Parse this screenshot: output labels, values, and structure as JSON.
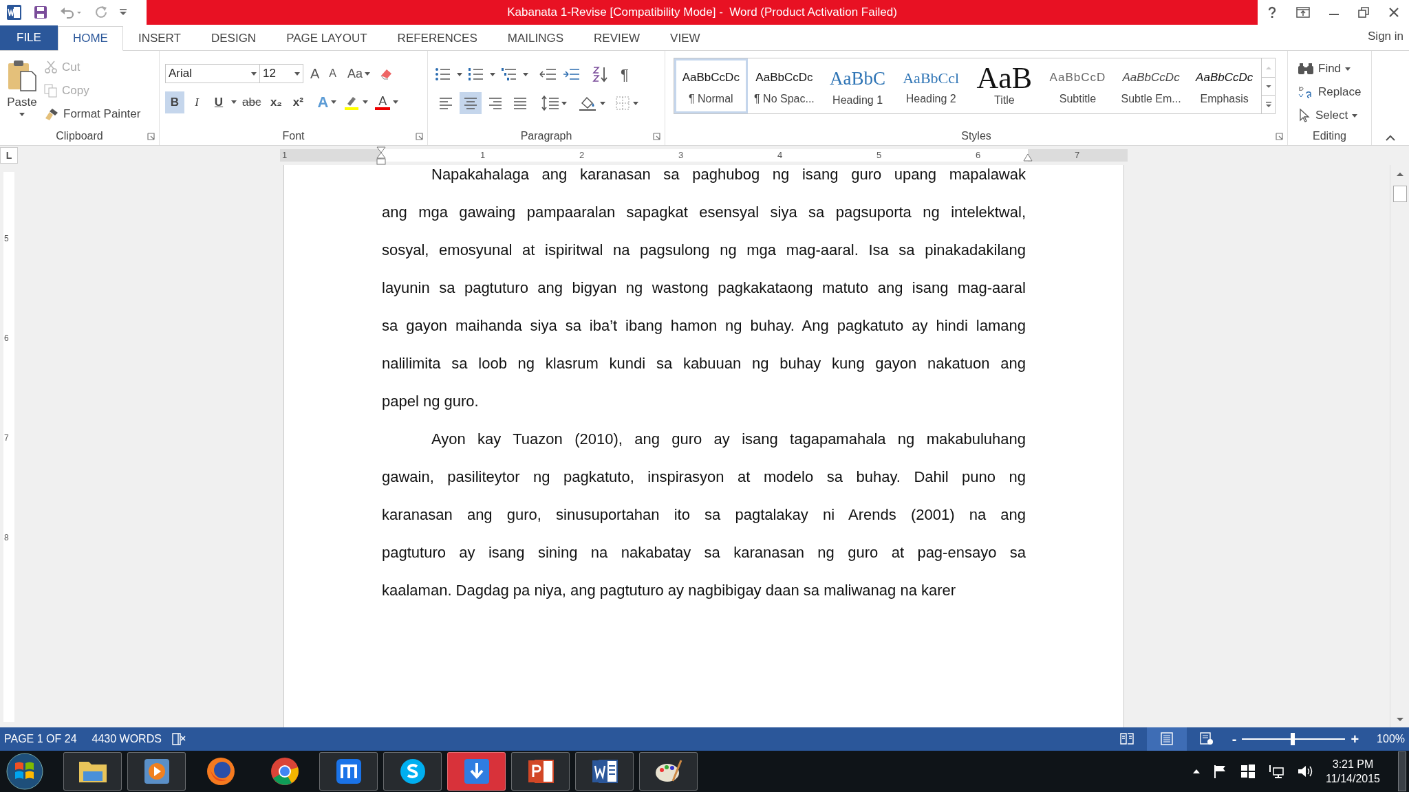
{
  "window": {
    "title": "Kabanata 1-Revise [Compatibility Mode] -  Word (Product Activation Failed)"
  },
  "tabs": [
    {
      "label": "FILE",
      "kind": "file",
      "selected": false
    },
    {
      "label": "HOME",
      "kind": "tab",
      "selected": true
    },
    {
      "label": "INSERT",
      "kind": "tab",
      "selected": false
    },
    {
      "label": "DESIGN",
      "kind": "tab",
      "selected": false
    },
    {
      "label": "PAGE LAYOUT",
      "kind": "tab",
      "selected": false
    },
    {
      "label": "REFERENCES",
      "kind": "tab",
      "selected": false
    },
    {
      "label": "MAILINGS",
      "kind": "tab",
      "selected": false
    },
    {
      "label": "REVIEW",
      "kind": "tab",
      "selected": false
    },
    {
      "label": "VIEW",
      "kind": "tab",
      "selected": false
    }
  ],
  "sign_in": "Sign in",
  "clipboard": {
    "label": "Clipboard",
    "paste": "Paste",
    "cut": {
      "label": "Cut",
      "disabled": true
    },
    "copy": {
      "label": "Copy",
      "disabled": true
    },
    "format_painter": {
      "label": "Format Painter",
      "disabled": false
    }
  },
  "font": {
    "label": "Font",
    "font_name": "Arial",
    "font_size": "12",
    "grow": "A",
    "shrink": "A",
    "change_case": "Aa",
    "formats": [
      {
        "label": "B",
        "kind": "bold",
        "selected": true
      },
      {
        "label": "I",
        "kind": "italic",
        "selected": false
      },
      {
        "label": "U",
        "kind": "underline",
        "selected": false
      },
      {
        "label": "abc",
        "kind": "strike",
        "selected": false
      },
      {
        "label": "x₂",
        "kind": "plain",
        "selected": false
      },
      {
        "label": "x²",
        "kind": "plain",
        "selected": false
      }
    ],
    "effects": "A",
    "font_color": "A"
  },
  "paragraph": {
    "label": "Paragraph",
    "show_marks": "¶",
    "alignments": [
      {
        "selected": false
      },
      {
        "selected": true
      },
      {
        "selected": false
      },
      {
        "selected": false
      }
    ]
  },
  "styles": {
    "label": "Styles",
    "items": [
      {
        "preview": "AaBbCcDc",
        "name": "¶ Normal",
        "kind": "plain",
        "selected": true
      },
      {
        "preview": "AaBbCcDc",
        "name": "¶ No Spac...",
        "kind": "plain",
        "selected": false
      },
      {
        "preview": "AaBbC",
        "name": "Heading 1",
        "kind": "heading1",
        "selected": false
      },
      {
        "preview": "AaBbCcl",
        "name": "Heading 2",
        "kind": "heading2",
        "selected": false
      },
      {
        "preview": "AaB",
        "name": "Title",
        "kind": "title",
        "selected": false
      },
      {
        "preview": "AaBbCcD",
        "name": "Subtitle",
        "kind": "subtitle",
        "selected": false
      },
      {
        "preview": "AaBbCcDc",
        "name": "Subtle Em...",
        "kind": "subtle",
        "selected": false
      },
      {
        "preview": "AaBbCcDc",
        "name": "Emphasis",
        "kind": "emphasis",
        "selected": false
      }
    ]
  },
  "editing": {
    "label": "Editing",
    "find": "Find",
    "replace": "Replace",
    "select": "Select"
  },
  "ruler": {
    "tab_selector": "L",
    "numbers": [
      "1",
      "1",
      "2",
      "3",
      "4",
      "5",
      "6",
      "7"
    ],
    "vertical_numbers": [
      "5",
      "6",
      "7",
      "8"
    ]
  },
  "document": {
    "paragraphs": [
      {
        "lines": [
          "Napakahalaga ang karanasan sa paghubog ng isang guro upang mapalawak",
          "ang mga gawaing pampaaralan sapagkat esensyal siya sa pagsuporta ng intelektwal,",
          "sosyal, emosyunal at ispiritwal na pagsulong ng mga mag-aaral. Isa sa pinakadakilang",
          "layunin sa pagtuturo ang bigyan ng wastong pagkakataong matuto ang isang mag-aaral",
          "sa gayon maihanda siya sa iba’t ibang hamon ng buhay. Ang pagkatuto ay hindi lamang",
          "nalilimita sa loob ng klasrum kundi sa kabuuan ng buhay kung gayon nakatuon ang",
          "papel ng guro."
        ]
      },
      {
        "lines": [
          "Ayon kay Tuazon (2010), ang guro ay isang tagapamahala ng makabuluhang",
          "gawain, pasiliteytor ng pagkatuto, inspirasyon at modelo sa buhay. Dahil puno ng",
          "karanasan ang guro, sinusuportahan ito sa pagtalakay ni Arends (2001) na ang",
          "pagtuturo ay isang sining na nakabatay sa karanasan ng guro at pag-ensayo sa",
          "kaalaman. Dagdag pa niya, ang pagtuturo ay nagbibigay daan sa maliwanag na karer"
        ]
      }
    ]
  },
  "status_bar": {
    "page": "PAGE 1 OF 24",
    "words": "4430 WORDS",
    "views": [
      {
        "selected": false
      },
      {
        "selected": true
      },
      {
        "selected": false
      }
    ],
    "zoom_out": "-",
    "zoom_in": "+",
    "zoom": {
      "level": 0.49
    },
    "zoom_value": "100%"
  },
  "taskbar": {
    "apps": [
      {
        "kind": "folder",
        "running": true
      },
      {
        "kind": "media",
        "running": true
      },
      {
        "kind": "firefox",
        "running": false
      },
      {
        "kind": "chrome",
        "running": false
      },
      {
        "kind": "maxthon",
        "running": true
      },
      {
        "kind": "skype",
        "running": true
      },
      {
        "kind": "download",
        "running": true
      },
      {
        "kind": "powerpoint",
        "running": true
      },
      {
        "kind": "word",
        "running": true
      },
      {
        "kind": "paint",
        "running": true
      }
    ],
    "time": "3:21 PM",
    "date": "11/14/2015"
  }
}
